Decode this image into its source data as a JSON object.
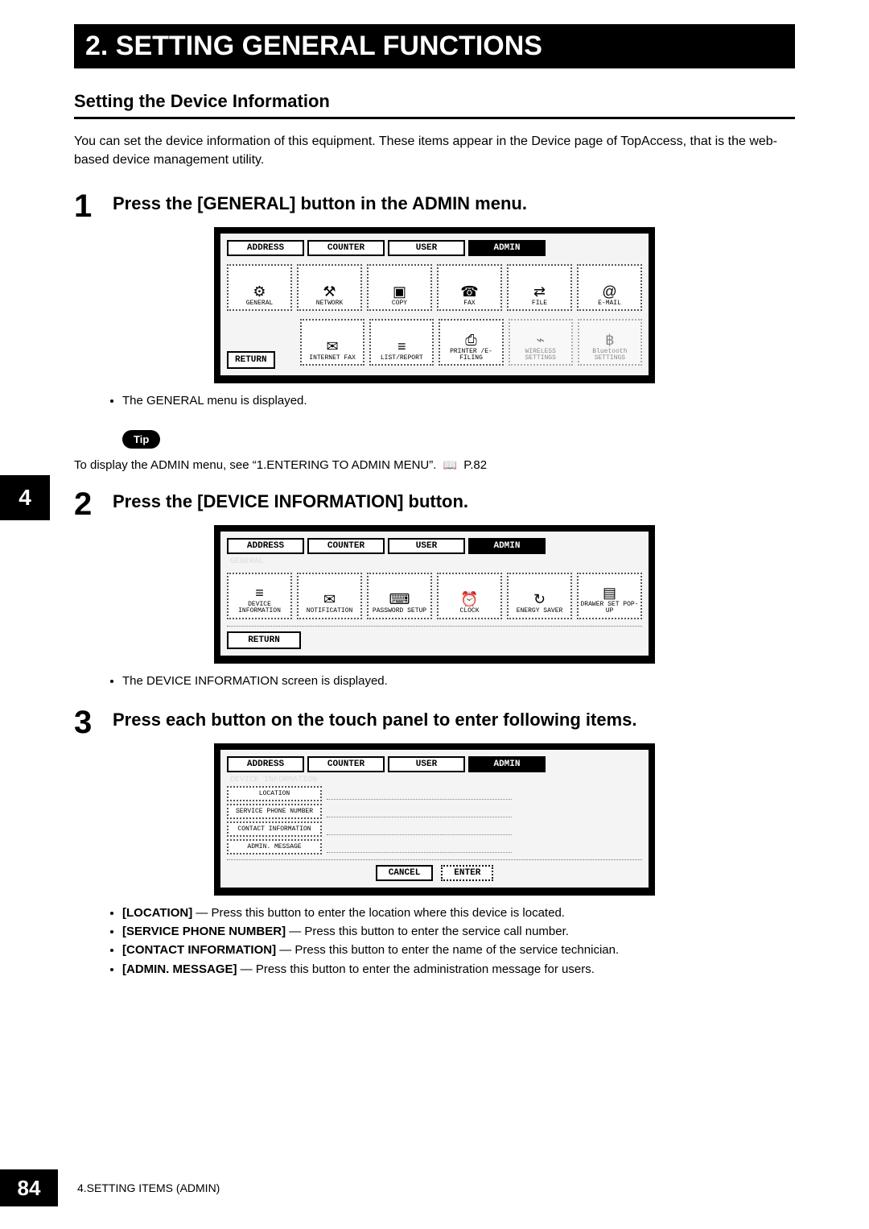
{
  "chapter_title": "2. SETTING GENERAL FUNCTIONS",
  "section_title": "Setting the Device Information",
  "intro": "You can set the device information of this equipment.  These items appear in the Device page of TopAccess, that is the web-based device management utility.",
  "side_tab": "4",
  "page_number": "84",
  "footer": "4.SETTING ITEMS (ADMIN)",
  "tip_badge": "Tip",
  "tip_text_prefix": "To display the ADMIN menu, see “1.ENTERING TO ADMIN MENU”.",
  "tip_text_page": "P.82",
  "steps": {
    "s1": {
      "num": "1",
      "title": "Press the [GENERAL] button in the ADMIN menu.",
      "after_bullet": "The GENERAL menu is displayed."
    },
    "s2": {
      "num": "2",
      "title": "Press the [DEVICE INFORMATION] button.",
      "after_bullet": "The DEVICE INFORMATION screen is displayed."
    },
    "s3": {
      "num": "3",
      "title": "Press each button on the touch panel to enter following items.",
      "bullets": [
        {
          "strong": "[LOCATION]",
          "rest": " — Press this button to enter the location where this device is located."
        },
        {
          "strong": "[SERVICE PHONE NUMBER]",
          "rest": " — Press this button to enter the service call number."
        },
        {
          "strong": "[CONTACT INFORMATION]",
          "rest": " — Press this button to enter the name of the service technician."
        },
        {
          "strong": "[ADMIN. MESSAGE]",
          "rest": " — Press this button to enter the administration message for users."
        }
      ]
    }
  },
  "panel_tabs": [
    "ADDRESS",
    "COUNTER",
    "USER",
    "ADMIN"
  ],
  "return_label": "RETURN",
  "panel1_grid_row1": [
    {
      "icon": "⚙",
      "label": "GENERAL"
    },
    {
      "icon": "⚒",
      "label": "NETWORK"
    },
    {
      "icon": "▣",
      "label": "COPY"
    },
    {
      "icon": "☎",
      "label": "FAX"
    },
    {
      "icon": "⇄",
      "label": "FILE"
    },
    {
      "icon": "@",
      "label": "E-MAIL"
    }
  ],
  "panel1_grid_row2": [
    {
      "icon": "✉",
      "label": "INTERNET FAX"
    },
    {
      "icon": "≡",
      "label": "LIST/REPORT"
    },
    {
      "icon": "⎙",
      "label": "PRINTER\n/E-FILING"
    },
    {
      "icon": "⌁",
      "label": "WIRELESS\nSETTINGS",
      "disabled": true
    },
    {
      "icon": "฿",
      "label": "Bluetooth\nSETTINGS",
      "disabled": true
    }
  ],
  "panel2_sub": "GENERAL",
  "panel2_grid": [
    {
      "icon": "≡",
      "label": "DEVICE\nINFORMATION"
    },
    {
      "icon": "✉",
      "label": "NOTIFICATION"
    },
    {
      "icon": "⌨",
      "label": "PASSWORD SETUP"
    },
    {
      "icon": "⏰",
      "label": "CLOCK"
    },
    {
      "icon": "↻",
      "label": "ENERGY\nSAVER"
    },
    {
      "icon": "▤",
      "label": "DRAWER SET\nPOP-UP"
    }
  ],
  "panel3_sub": "DEVICE INFORMATION",
  "panel3_fields": [
    "LOCATION",
    "SERVICE PHONE NUMBER",
    "CONTACT INFORMATION",
    "ADMIN. MESSAGE"
  ],
  "panel3_actions": [
    "CANCEL",
    "ENTER"
  ]
}
